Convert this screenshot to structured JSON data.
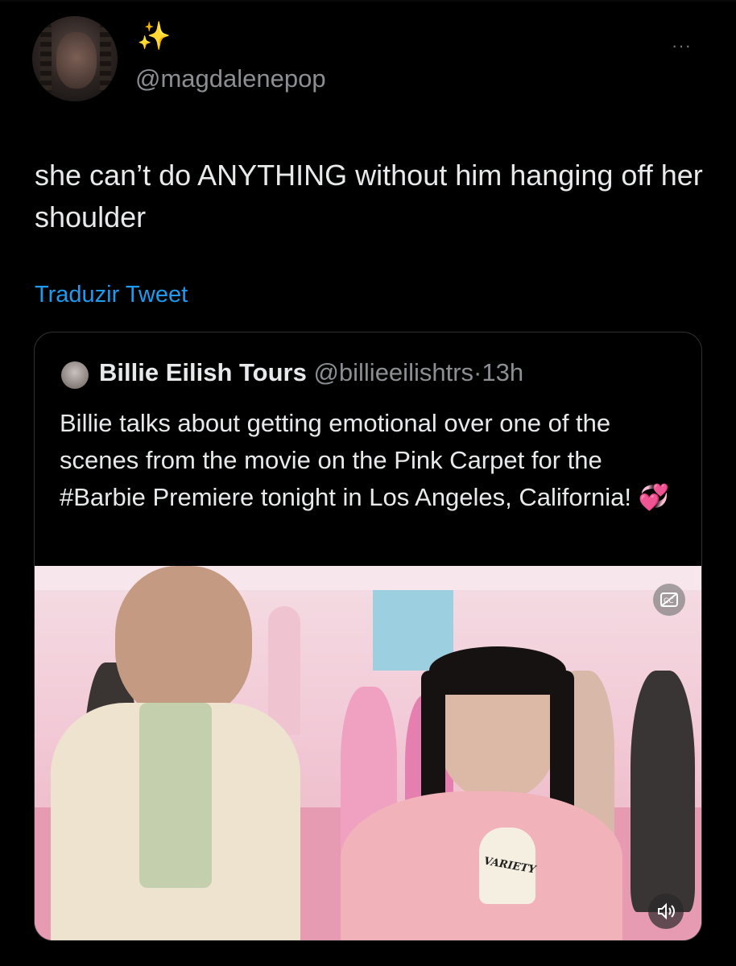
{
  "tweet": {
    "display_name_emoji": "✨",
    "handle": "@magdalenepop",
    "more_icon": "···",
    "text": "she can’t do ANYTHING without him hanging off her shoulder",
    "translate_label": "Traduzir Tweet"
  },
  "quoted_tweet": {
    "author_name": "Billie Eilish Tours",
    "author_handle": "@billieeilishtrs",
    "separator": "·",
    "time": "13h",
    "text": "Billie talks about getting emotional over one of the scenes from the movie on the Pink Carpet for the #Barbie Premiere tonight in Los Angeles, California!",
    "emoji": "💞",
    "media": {
      "type": "video",
      "captions_icon": "closed-captions-off-icon",
      "volume_icon": "volume-muted-icon",
      "mic_brand": "VARIETY"
    }
  },
  "colors": {
    "background": "#000000",
    "text": "#e7e9ea",
    "secondary_text": "#8b8f94",
    "link": "#1d9bf0",
    "border": "#2f3336"
  }
}
